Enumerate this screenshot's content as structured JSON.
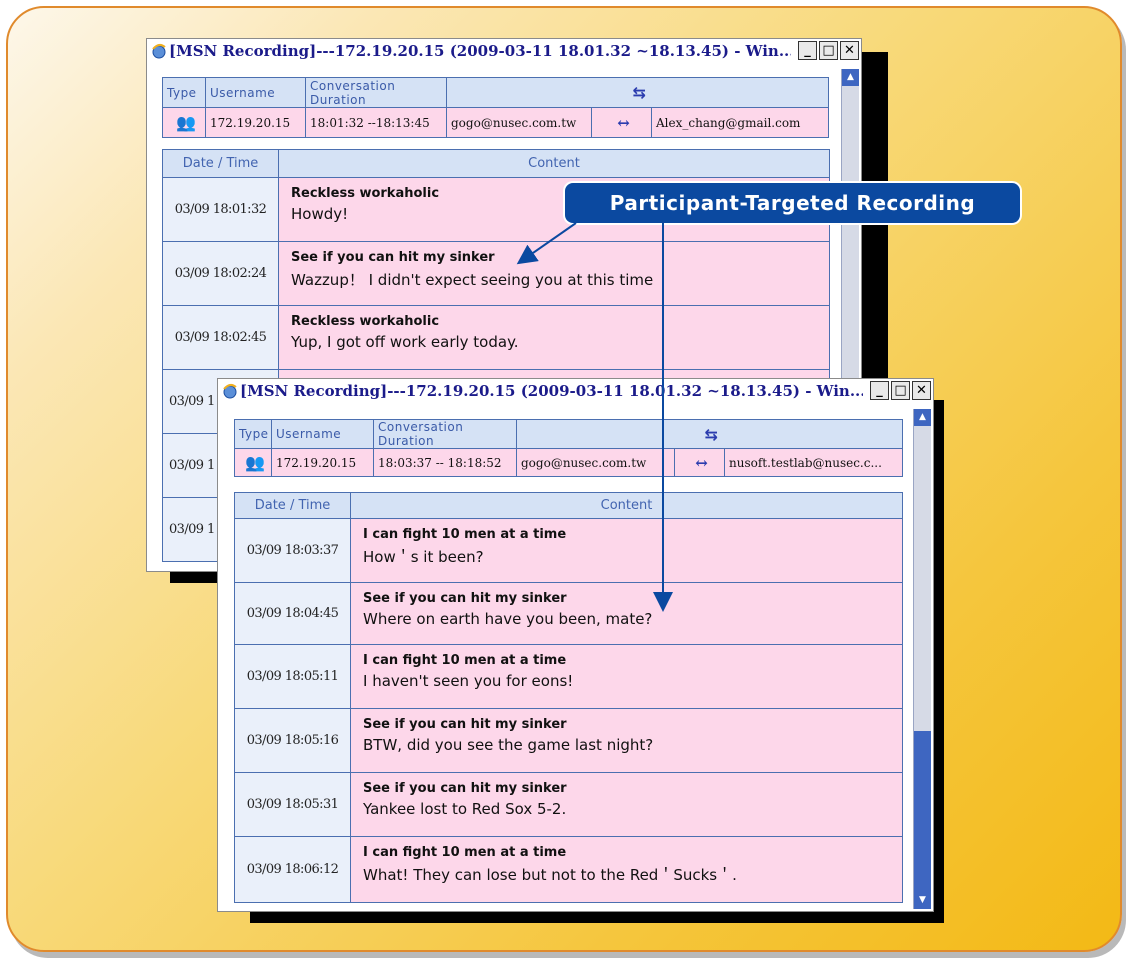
{
  "windows": [
    {
      "title": "[MSN Recording]---172.19.20.15  (2009-03-11 18.01.32 ~18.13.45) - Win...",
      "controls": [
        "_",
        "□",
        "✕"
      ],
      "header": {
        "labels": [
          "Type",
          "Username",
          "Conversation Duration"
        ],
        "pair_icon": "⇆",
        "username": "172.19.20.15",
        "duration": "18:01:32 --18:13:45",
        "from": "gogo@nusec.com.tw",
        "arrow": "↔",
        "to": "Alex_chang@gmail.com"
      },
      "columns": [
        "Date / Time",
        "Content"
      ],
      "rows": [
        {
          "time": "03/09 18:01:32",
          "sender": "Reckless workaholic",
          "message": "Howdy!"
        },
        {
          "time": "03/09 18:02:24",
          "sender": "See if you can hit my sinker",
          "message": "Wazzup！ I  didn't expect seeing you at this time"
        },
        {
          "time": "03/09 18:02:45",
          "sender": "Reckless workaholic",
          "message": "Yup, I got off work early today."
        },
        {
          "time": "03/09 1",
          "sender": "",
          "message": ""
        },
        {
          "time": "03/09 1",
          "sender": "",
          "message": ""
        },
        {
          "time": "03/09 1",
          "sender": "",
          "message": ""
        }
      ]
    },
    {
      "title": "[MSN Recording]---172.19.20.15  (2009-03-11 18.01.32 ~18.13.45) - Win...",
      "controls": [
        "_",
        "□",
        "✕"
      ],
      "header": {
        "labels": [
          "Type",
          "Username",
          "Conversation Duration"
        ],
        "pair_icon": "⇆",
        "username": "172.19.20.15",
        "duration": "18:03:37 -- 18:18:52",
        "from": "gogo@nusec.com.tw",
        "arrow": "↔",
        "to": "nusoft.testlab@nusec.c..."
      },
      "columns": [
        "Date / Time",
        "Content"
      ],
      "rows": [
        {
          "time": "03/09 18:03:37",
          "sender": "I can fight 10 men at a time",
          "message": "How＇s it been?"
        },
        {
          "time": "03/09 18:04:45",
          "sender": "See if you can hit my sinker",
          "message": "Where on earth have you been, mate?"
        },
        {
          "time": "03/09 18:05:11",
          "sender": "I can fight 10 men at a time",
          "message": "I haven't seen you for eons!"
        },
        {
          "time": "03/09 18:05:16",
          "sender": "See if you can hit my sinker",
          "message": "BTW, did you see the game last night?"
        },
        {
          "time": "03/09 18:05:31",
          "sender": "See if you can hit my sinker",
          "message": "Yankee lost to  Red Sox  5-2."
        },
        {
          "time": "03/09 18:06:12",
          "sender": "I can fight 10 men at a time",
          "message": "What! They can lose but not to the Red＇Sucks＇."
        }
      ]
    }
  ],
  "callout": {
    "label": "Participant-Targeted Recording"
  },
  "colors": {
    "accent": "#0b49a0",
    "row_pink": "#fdd7ea",
    "header_blue": "#d5e2f5",
    "title_text": "#1b1b8a"
  }
}
